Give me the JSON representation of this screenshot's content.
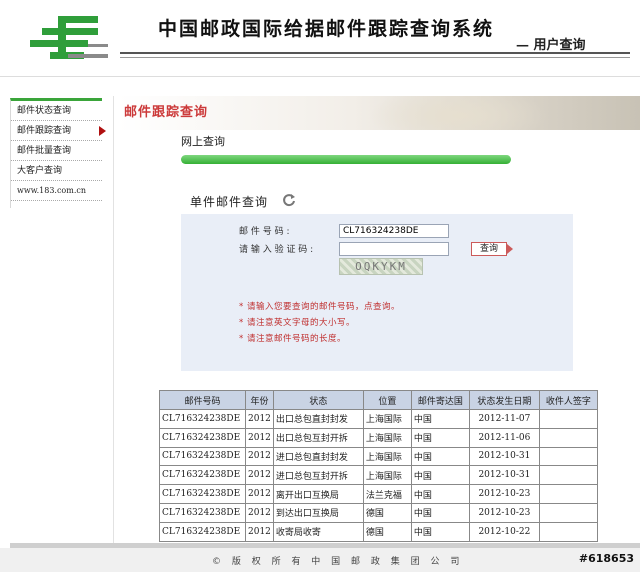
{
  "header": {
    "site_title": "中国邮政国际给据邮件跟踪查询系统",
    "user_query": "— 用户查询"
  },
  "sidebar": {
    "items": [
      {
        "label": "邮件状态查询"
      },
      {
        "label": "邮件跟踪查询"
      },
      {
        "label": "邮件批量查询"
      },
      {
        "label": "大客户查询"
      },
      {
        "label": "www.183.com.cn"
      }
    ]
  },
  "main": {
    "banner_title": "邮件跟踪查询",
    "online_title": "网上查询",
    "section_title": "单件邮件查询",
    "form": {
      "tracking_label": "邮 件 号 码 :",
      "tracking_value": "CL716324238DE",
      "captcha_label": "请 输 入 验 证 码 :",
      "captcha_value": "",
      "captcha_text": "OQKYKM",
      "query_button": "查询",
      "notes": [
        "* 请输入您要查询的邮件号码，点查询。",
        "* 请注意英文字母的大小写。",
        "* 请注意邮件号码的长度。"
      ]
    },
    "table": {
      "headers": [
        "邮件号码",
        "年份",
        "状态",
        "位置",
        "邮件寄达国",
        "状态发生日期",
        "收件人签字"
      ],
      "rows": [
        [
          "CL716324238DE",
          "2012",
          "出口总包直封封发",
          "上海国际",
          "中国",
          "2012-11-07",
          ""
        ],
        [
          "CL716324238DE",
          "2012",
          "出口总包互封开拆",
          "上海国际",
          "中国",
          "2012-11-06",
          ""
        ],
        [
          "CL716324238DE",
          "2012",
          "进口总包直封封发",
          "上海国际",
          "中国",
          "2012-10-31",
          ""
        ],
        [
          "CL716324238DE",
          "2012",
          "进口总包互封开拆",
          "上海国际",
          "中国",
          "2012-10-31",
          ""
        ],
        [
          "CL716324238DE",
          "2012",
          "离开出口互换局",
          "法兰克福",
          "中国",
          "2012-10-23",
          ""
        ],
        [
          "CL716324238DE",
          "2012",
          "到达出口互换局",
          "德国",
          "中国",
          "2012-10-23",
          ""
        ],
        [
          "CL716324238DE",
          "2012",
          "收寄局收寄",
          "德国",
          "中国",
          "2012-10-22",
          ""
        ]
      ]
    }
  },
  "footer": {
    "copyright": "© 版 权 所 有 中 国 邮 政 集 团 公 司",
    "watermark": "#618653"
  },
  "colors": {
    "accent_green": "#35b035",
    "accent_red": "#cc3a3a",
    "panel_bg": "#e9eef7",
    "table_header_bg": "#c9d3e4"
  },
  "icons": {
    "logo": "china-post-logo",
    "active_item": "arrow-right-icon",
    "refresh": "refresh-icon"
  }
}
